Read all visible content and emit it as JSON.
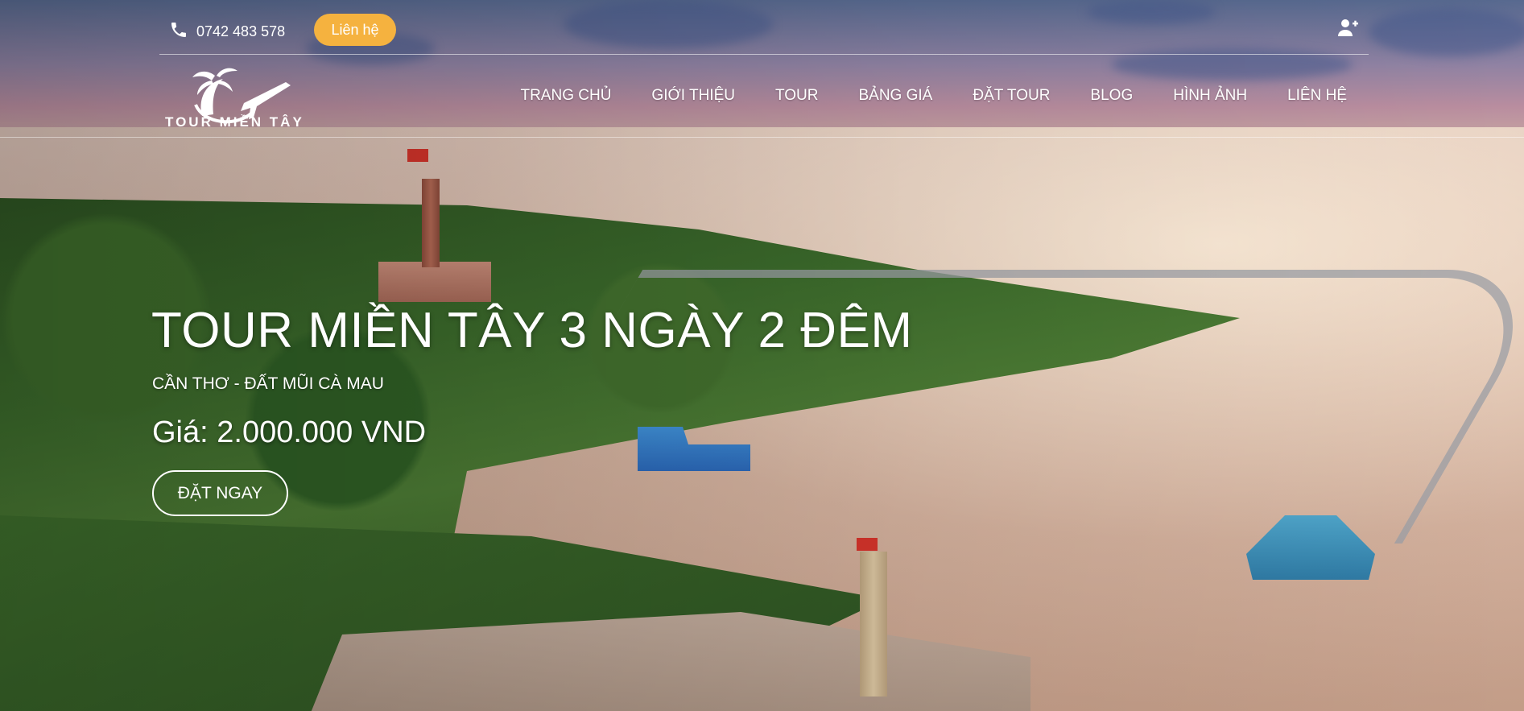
{
  "topbar": {
    "phone": "0742 483 578",
    "contact_button": "Liên hệ"
  },
  "brand": {
    "name": "TOUR MIỀN TÂY"
  },
  "nav": {
    "items": [
      "TRANG CHỦ",
      "GIỚI THIỆU",
      "TOUR",
      "BẢNG GIÁ",
      "ĐẶT TOUR",
      "BLOG",
      "HÌNH ẢNH",
      "LIÊN HỆ"
    ]
  },
  "hero": {
    "title": "TOUR MIỀN TÂY 3 NGÀY 2 ĐÊM",
    "subtitle": "CẦN THƠ - ĐẤT MŨI CÀ MAU",
    "price": "Giá: 2.000.000 VND",
    "cta": "ĐẶT NGAY"
  },
  "icons": {
    "phone": "phone-icon",
    "user": "user-plus-icon",
    "logo": "palm-airplane-logo"
  },
  "colors": {
    "accent": "#f5b23f",
    "text": "#ffffff"
  }
}
